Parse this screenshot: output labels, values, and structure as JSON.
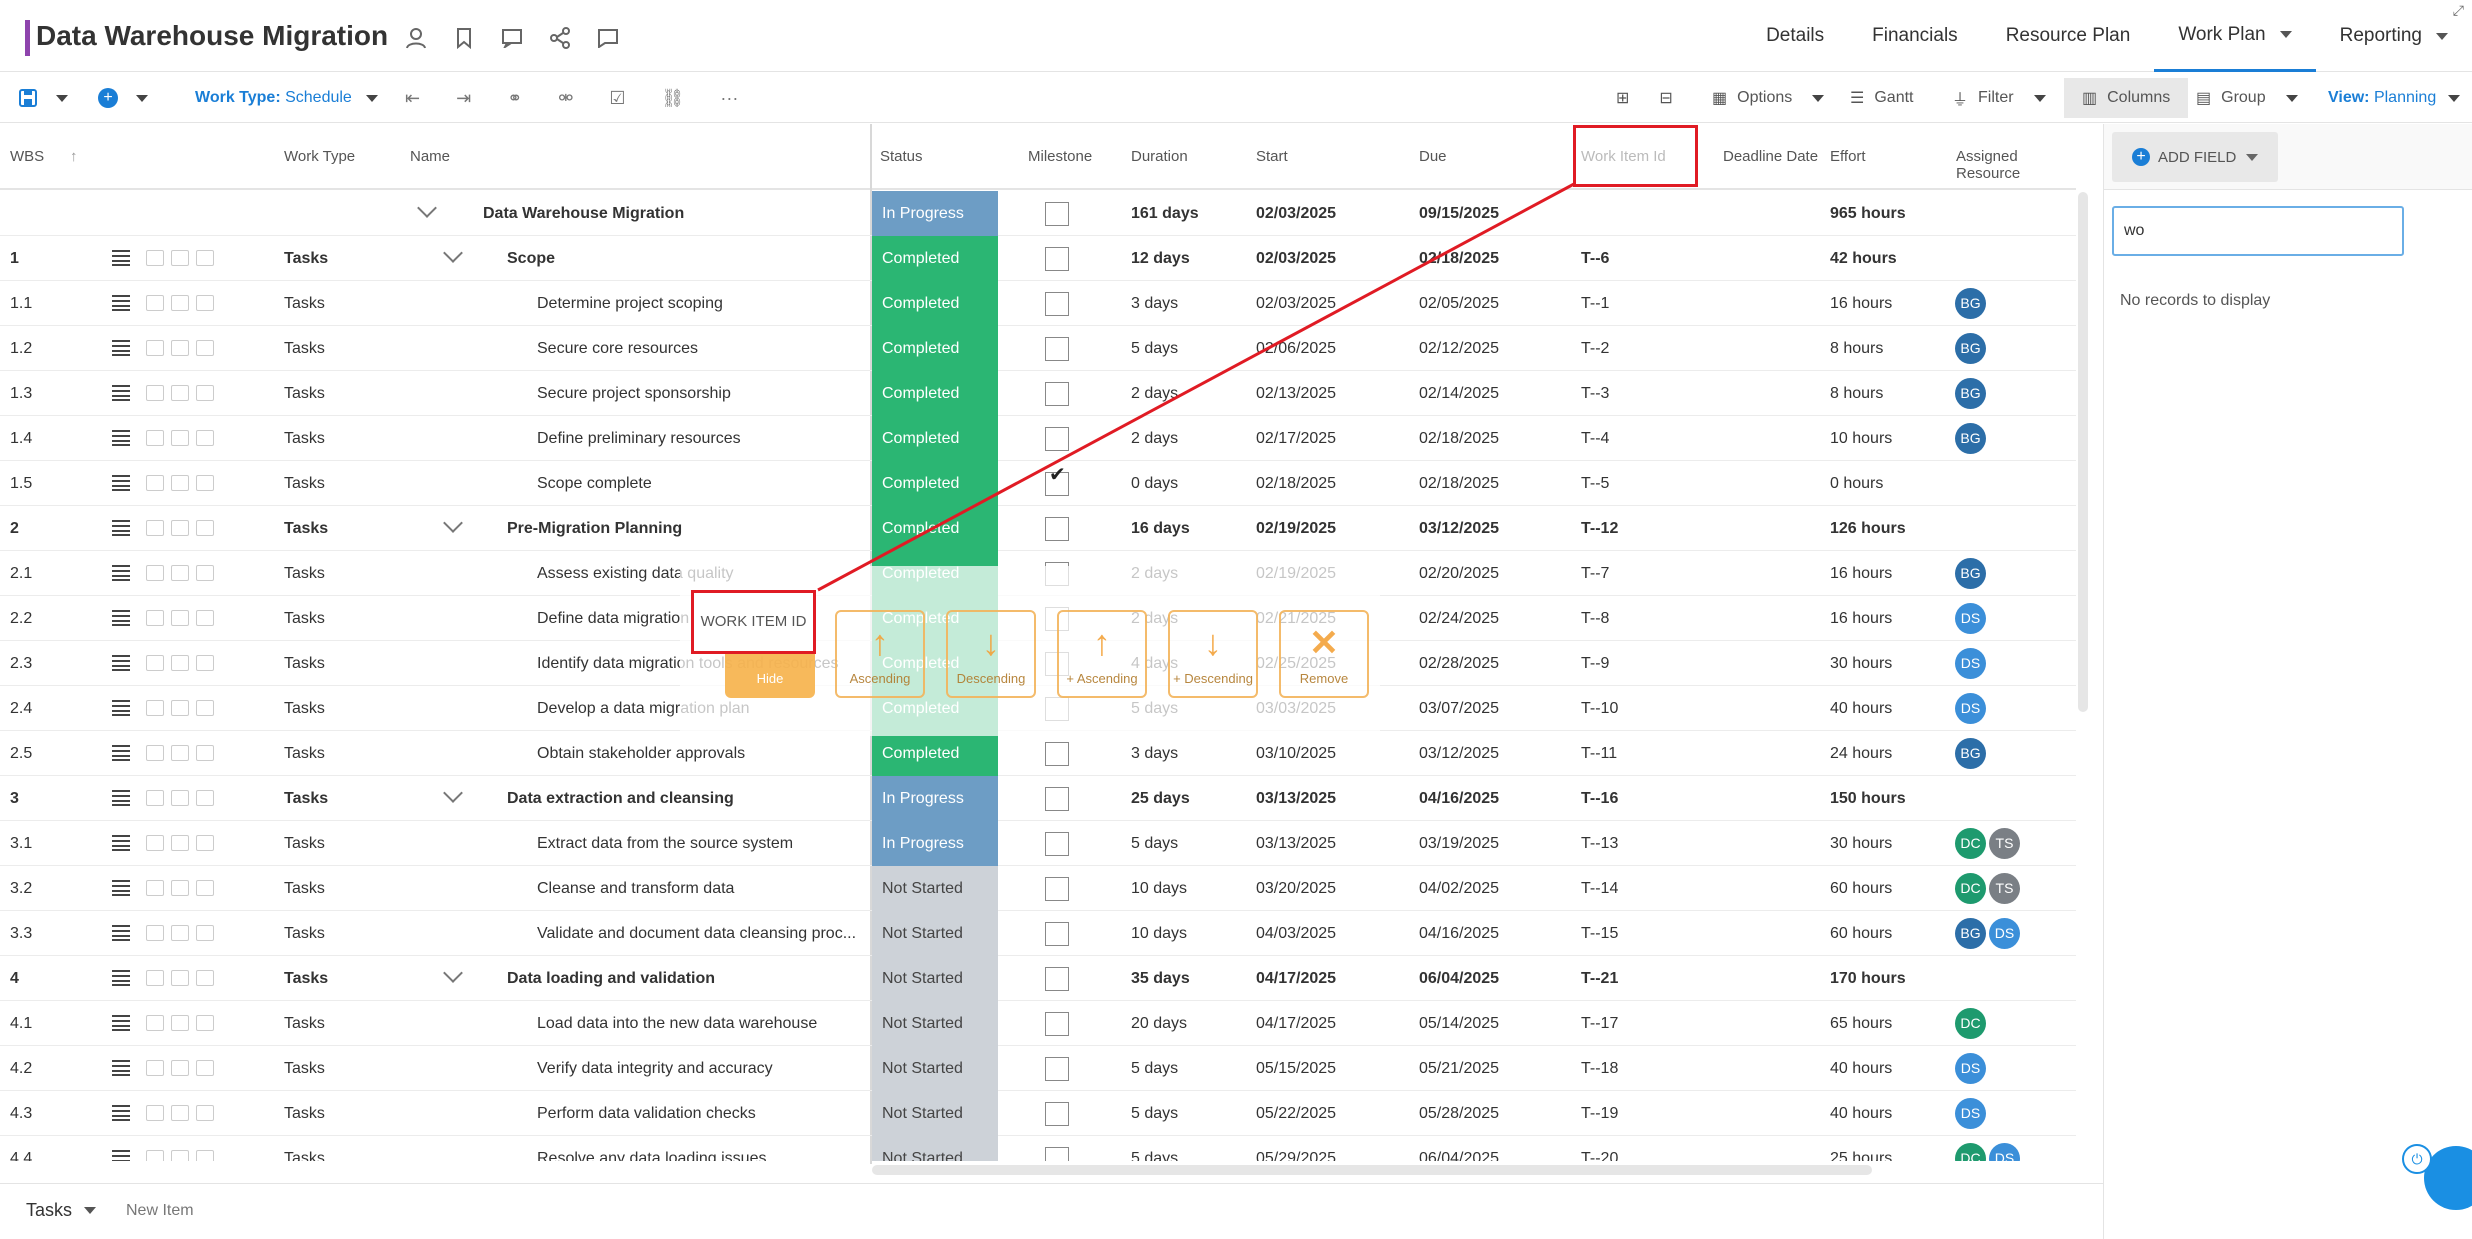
{
  "header": {
    "title": "Data Warehouse Migration",
    "nav": [
      "Details",
      "Financials",
      "Resource Plan",
      "Work Plan",
      "Reporting"
    ],
    "active_nav": "Work Plan"
  },
  "toolbar": {
    "work_type_label": "Work Type:",
    "work_type_value": "Schedule",
    "options": "Options",
    "gantt": "Gantt",
    "filter": "Filter",
    "columns": "Columns",
    "group": "Group",
    "view_label": "View:",
    "view_value": "Planning",
    "more": "···"
  },
  "columns": [
    "WBS",
    "Work Type",
    "Name",
    "Status",
    "Milestone",
    "Duration",
    "Start",
    "Due",
    "Work Item Id",
    "Deadline Date",
    "Effort",
    "Assigned Resource"
  ],
  "rows": [
    {
      "wbs": "",
      "type": "",
      "name": "Data Warehouse Migration",
      "status": "In Progress",
      "status_kind": "progress",
      "milestone": false,
      "duration": "161 days",
      "start": "02/03/2025",
      "due": "09/15/2025",
      "id": "",
      "effort": "965 hours",
      "bold": true,
      "level": 0,
      "avatars": []
    },
    {
      "wbs": "1",
      "type": "Tasks",
      "name": "Scope",
      "status": "Completed",
      "status_kind": "done",
      "milestone": false,
      "duration": "12 days",
      "start": "02/03/2025",
      "due": "02/18/2025",
      "id": "T--6",
      "effort": "42 hours",
      "bold": true,
      "level": 1,
      "avatars": []
    },
    {
      "wbs": "1.1",
      "type": "Tasks",
      "name": "Determine project scoping",
      "status": "Completed",
      "status_kind": "done",
      "milestone": false,
      "duration": "3 days",
      "start": "02/03/2025",
      "due": "02/05/2025",
      "id": "T--1",
      "effort": "16 hours",
      "bold": false,
      "level": 2,
      "avatars": [
        "BG"
      ]
    },
    {
      "wbs": "1.2",
      "type": "Tasks",
      "name": "Secure core resources",
      "status": "Completed",
      "status_kind": "done",
      "milestone": false,
      "duration": "5 days",
      "start": "02/06/2025",
      "due": "02/12/2025",
      "id": "T--2",
      "effort": "8 hours",
      "bold": false,
      "level": 2,
      "avatars": [
        "BG"
      ]
    },
    {
      "wbs": "1.3",
      "type": "Tasks",
      "name": "Secure project sponsorship",
      "status": "Completed",
      "status_kind": "done",
      "milestone": false,
      "duration": "2 days",
      "start": "02/13/2025",
      "due": "02/14/2025",
      "id": "T--3",
      "effort": "8 hours",
      "bold": false,
      "level": 2,
      "avatars": [
        "BG"
      ]
    },
    {
      "wbs": "1.4",
      "type": "Tasks",
      "name": "Define preliminary resources",
      "status": "Completed",
      "status_kind": "done",
      "milestone": false,
      "duration": "2 days",
      "start": "02/17/2025",
      "due": "02/18/2025",
      "id": "T--4",
      "effort": "10 hours",
      "bold": false,
      "level": 2,
      "avatars": [
        "BG"
      ]
    },
    {
      "wbs": "1.5",
      "type": "Tasks",
      "name": "Scope complete",
      "status": "Completed",
      "status_kind": "done",
      "milestone": true,
      "duration": "0 days",
      "start": "02/18/2025",
      "due": "02/18/2025",
      "id": "T--5",
      "effort": "0 hours",
      "bold": false,
      "level": 2,
      "avatars": []
    },
    {
      "wbs": "2",
      "type": "Tasks",
      "name": "Pre-Migration Planning",
      "status": "Completed",
      "status_kind": "done",
      "milestone": false,
      "duration": "16 days",
      "start": "02/19/2025",
      "due": "03/12/2025",
      "id": "T--12",
      "effort": "126 hours",
      "bold": true,
      "level": 1,
      "avatars": []
    },
    {
      "wbs": "2.1",
      "type": "Tasks",
      "name": "Assess existing data quality",
      "status": "Completed",
      "status_kind": "done",
      "milestone": false,
      "duration": "2 days",
      "start": "02/19/2025",
      "due": "02/20/2025",
      "id": "T--7",
      "effort": "16 hours",
      "bold": false,
      "level": 2,
      "avatars": [
        "BG"
      ]
    },
    {
      "wbs": "2.2",
      "type": "Tasks",
      "name": "Define data migration",
      "status": "Completed",
      "status_kind": "done",
      "milestone": false,
      "duration": "2 days",
      "start": "02/21/2025",
      "due": "02/24/2025",
      "id": "T--8",
      "effort": "16 hours",
      "bold": false,
      "level": 2,
      "avatars": [
        "DS"
      ]
    },
    {
      "wbs": "2.3",
      "type": "Tasks",
      "name": "Identify data migration tools and resources",
      "status": "Completed",
      "status_kind": "done",
      "milestone": false,
      "duration": "4 days",
      "start": "02/25/2025",
      "due": "02/28/2025",
      "id": "T--9",
      "effort": "30 hours",
      "bold": false,
      "level": 2,
      "avatars": [
        "DS"
      ]
    },
    {
      "wbs": "2.4",
      "type": "Tasks",
      "name": "Develop a data migration plan",
      "status": "Completed",
      "status_kind": "done",
      "milestone": false,
      "duration": "5 days",
      "start": "03/03/2025",
      "due": "03/07/2025",
      "id": "T--10",
      "effort": "40 hours",
      "bold": false,
      "level": 2,
      "avatars": [
        "DS"
      ]
    },
    {
      "wbs": "2.5",
      "type": "Tasks",
      "name": "Obtain stakeholder approvals",
      "status": "Completed",
      "status_kind": "done",
      "milestone": false,
      "duration": "3 days",
      "start": "03/10/2025",
      "due": "03/12/2025",
      "id": "T--11",
      "effort": "24 hours",
      "bold": false,
      "level": 2,
      "avatars": [
        "BG"
      ]
    },
    {
      "wbs": "3",
      "type": "Tasks",
      "name": "Data extraction and cleansing",
      "status": "In Progress",
      "status_kind": "progress",
      "milestone": false,
      "duration": "25 days",
      "start": "03/13/2025",
      "due": "04/16/2025",
      "id": "T--16",
      "effort": "150 hours",
      "bold": true,
      "level": 1,
      "avatars": []
    },
    {
      "wbs": "3.1",
      "type": "Tasks",
      "name": "Extract data from the source system",
      "status": "In Progress",
      "status_kind": "progress",
      "milestone": false,
      "duration": "5 days",
      "start": "03/13/2025",
      "due": "03/19/2025",
      "id": "T--13",
      "effort": "30 hours",
      "bold": false,
      "level": 2,
      "avatars": [
        "DC",
        "TS"
      ]
    },
    {
      "wbs": "3.2",
      "type": "Tasks",
      "name": "Cleanse and transform data",
      "status": "Not Started",
      "status_kind": "not",
      "milestone": false,
      "duration": "10 days",
      "start": "03/20/2025",
      "due": "04/02/2025",
      "id": "T--14",
      "effort": "60 hours",
      "bold": false,
      "level": 2,
      "avatars": [
        "DC",
        "TS"
      ]
    },
    {
      "wbs": "3.3",
      "type": "Tasks",
      "name": "Validate and document data cleansing proc...",
      "status": "Not Started",
      "status_kind": "not",
      "milestone": false,
      "duration": "10 days",
      "start": "04/03/2025",
      "due": "04/16/2025",
      "id": "T--15",
      "effort": "60 hours",
      "bold": false,
      "level": 2,
      "avatars": [
        "BG",
        "DS"
      ]
    },
    {
      "wbs": "4",
      "type": "Tasks",
      "name": "Data loading and validation",
      "status": "Not Started",
      "status_kind": "not",
      "milestone": false,
      "duration": "35 days",
      "start": "04/17/2025",
      "due": "06/04/2025",
      "id": "T--21",
      "effort": "170 hours",
      "bold": true,
      "level": 1,
      "avatars": []
    },
    {
      "wbs": "4.1",
      "type": "Tasks",
      "name": "Load data into the new data warehouse",
      "status": "Not Started",
      "status_kind": "not",
      "milestone": false,
      "duration": "20 days",
      "start": "04/17/2025",
      "due": "05/14/2025",
      "id": "T--17",
      "effort": "65 hours",
      "bold": false,
      "level": 2,
      "avatars": [
        "DC"
      ]
    },
    {
      "wbs": "4.2",
      "type": "Tasks",
      "name": "Verify data integrity and accuracy",
      "status": "Not Started",
      "status_kind": "not",
      "milestone": false,
      "duration": "5 days",
      "start": "05/15/2025",
      "due": "05/21/2025",
      "id": "T--18",
      "effort": "40 hours",
      "bold": false,
      "level": 2,
      "avatars": [
        "DS"
      ]
    },
    {
      "wbs": "4.3",
      "type": "Tasks",
      "name": "Perform data validation checks",
      "status": "Not Started",
      "status_kind": "not",
      "milestone": false,
      "duration": "5 days",
      "start": "05/22/2025",
      "due": "05/28/2025",
      "id": "T--19",
      "effort": "40 hours",
      "bold": false,
      "level": 2,
      "avatars": [
        "DS"
      ]
    },
    {
      "wbs": "4.4",
      "type": "Tasks",
      "name": "Resolve any data loading issues",
      "status": "Not Started",
      "status_kind": "not",
      "milestone": false,
      "duration": "5 days",
      "start": "05/29/2025",
      "due": "06/04/2025",
      "id": "T--20",
      "effort": "25 hours",
      "bold": false,
      "level": 2,
      "avatars": [
        "DC",
        "DS"
      ]
    }
  ],
  "drag": {
    "label": "WORK ITEM ID",
    "hide": "Hide",
    "asc": "Ascending",
    "desc": "Descending",
    "add_asc": "+ Ascending",
    "add_desc": "+ Descending",
    "remove": "Remove"
  },
  "side_panel": {
    "add_field": "ADD FIELD",
    "search_value": "wo",
    "empty": "No records to display"
  },
  "footer": {
    "type": "Tasks",
    "new_item": "New Item"
  },
  "colors": {
    "accent": "#1a7ed6",
    "in_progress": "#6d9dc5",
    "completed": "#2bb673",
    "not_started": "#cdd2d8",
    "highlight": "#e01b24"
  }
}
